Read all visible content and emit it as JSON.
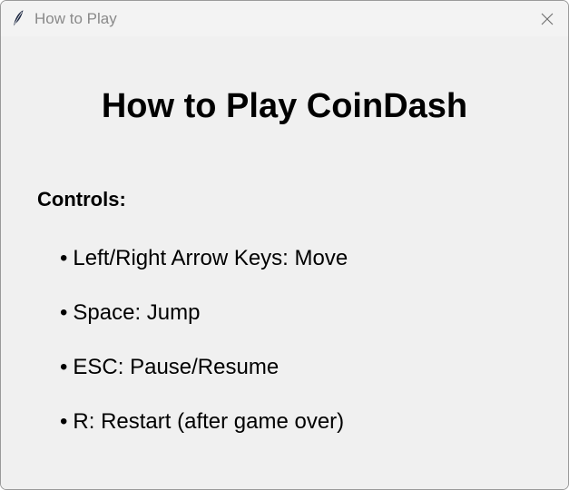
{
  "window": {
    "title": "How to Play",
    "icon": "feather-icon",
    "close_icon": "close-icon"
  },
  "content": {
    "heading": "How to Play CoinDash",
    "section_label": "Controls:",
    "bullet": "•",
    "controls": [
      "Left/Right Arrow Keys: Move",
      "Space: Jump",
      "ESC: Pause/Resume",
      "R: Restart (after game over)"
    ]
  },
  "colors": {
    "background": "#f0f0f0",
    "titlebar": "#f3f3f3",
    "title_text": "#8a8a8a",
    "text": "#000000"
  }
}
